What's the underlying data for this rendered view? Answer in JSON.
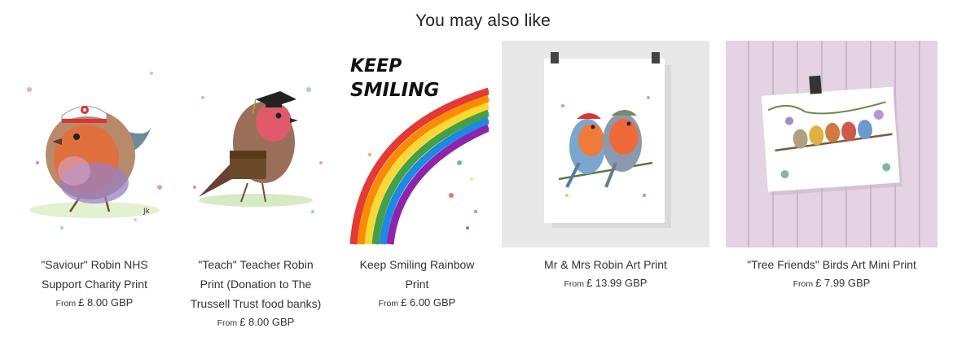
{
  "section": {
    "heading": "You may also like"
  },
  "products": [
    {
      "name": "\"Saviour\" Robin NHS Support Charity Print",
      "title_lines": [
        "\"Saviour\" Robin NHS",
        "Support Charity Print"
      ],
      "from_label": "From",
      "price": "£ 8.00 GBP"
    },
    {
      "name": "\"Teach\" Teacher Robin Print (Donation to The Trussell Trust food banks)",
      "title_lines": [
        "\"Teach\" Teacher Robin",
        "Print (Donation to The",
        "Trussell Trust food banks)"
      ],
      "from_label": "From",
      "price": "£ 8.00 GBP"
    },
    {
      "name": "Keep Smiling Rainbow Print",
      "title_lines": [
        "Keep Smiling Rainbow",
        "Print"
      ],
      "from_label": "From",
      "price": "£ 6.00 GBP",
      "art_text": [
        "KEEP",
        "SMILING"
      ]
    },
    {
      "name": "Mr & Mrs Robin Art Print",
      "title_lines": [
        "Mr & Mrs Robin Art Print"
      ],
      "from_label": "From",
      "price": "£ 13.99 GBP"
    },
    {
      "name": "\"Tree Friends\" Birds Art Mini Print",
      "title_lines": [
        "\"Tree Friends\" Birds Art Mini Print"
      ],
      "from_label": "From",
      "price": "£ 7.99 GBP"
    }
  ]
}
